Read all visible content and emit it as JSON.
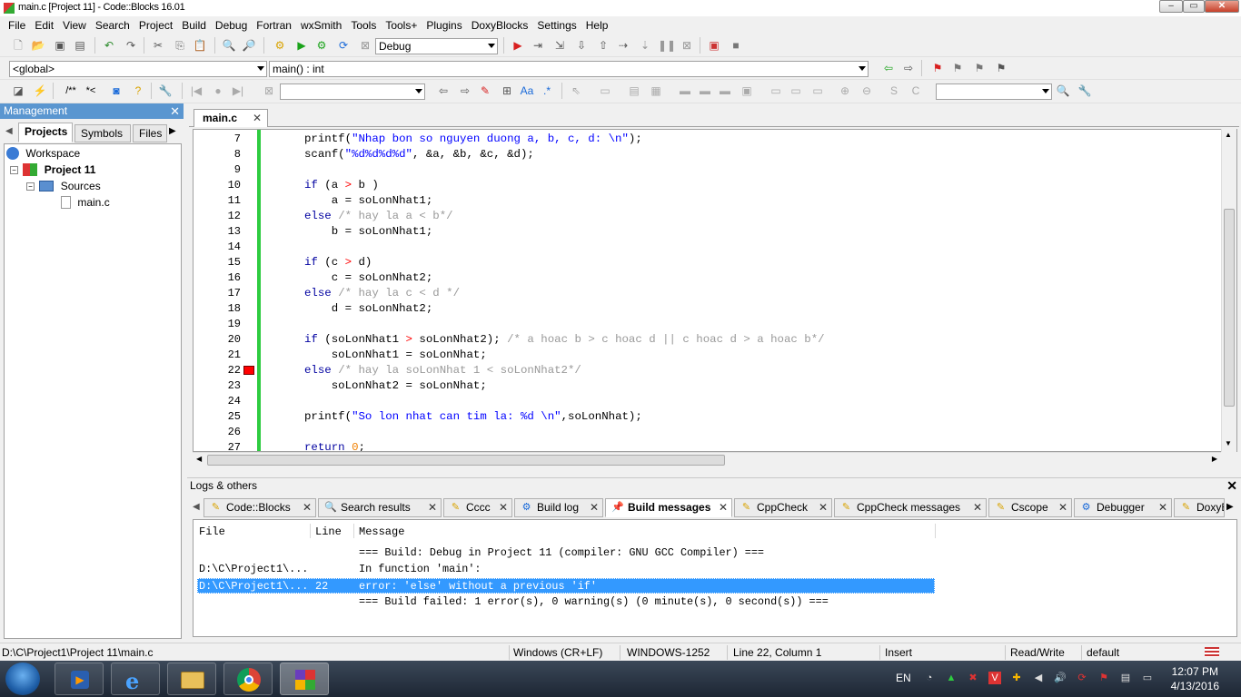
{
  "window": {
    "title": "main.c [Project 11] - Code::Blocks 16.01",
    "buttons": [
      "–",
      "▭",
      "✕"
    ]
  },
  "menu": [
    "File",
    "Edit",
    "View",
    "Search",
    "Project",
    "Build",
    "Debug",
    "Fortran",
    "wxSmith",
    "Tools",
    "Tools+",
    "Plugins",
    "DoxyBlocks",
    "Settings",
    "Help"
  ],
  "toolbar": {
    "build_target": "Debug"
  },
  "code_nav": {
    "scope": "<global>",
    "function": "main() : int"
  },
  "management": {
    "title": "Management",
    "tabs": [
      "Projects",
      "Symbols",
      "Files"
    ],
    "tree": {
      "workspace": "Workspace",
      "project": "Project 11",
      "folder": "Sources",
      "file": "main.c"
    }
  },
  "editor": {
    "tab": "main.c",
    "error_line": 22,
    "lines": [
      {
        "n": "7",
        "html": "printf(<span class='str'>\"Nhap bon so nguyen duong a, b, c, d: \\n\"</span>);"
      },
      {
        "n": "8",
        "html": "scanf(<span class='str'>\"%d%d%d%d\"</span>, &amp;a, &amp;b, &amp;c, &amp;d);"
      },
      {
        "n": "9",
        "html": ""
      },
      {
        "n": "10",
        "html": "<span class='kw'>if</span> (a <span class='op'>&gt;</span> b )"
      },
      {
        "n": "11",
        "html": "    a = soLonNhat1;"
      },
      {
        "n": "12",
        "html": "<span class='kw'>else</span> <span class='cm'>/* hay la a &lt; b*/</span>"
      },
      {
        "n": "13",
        "html": "    b = soLonNhat1;"
      },
      {
        "n": "14",
        "html": ""
      },
      {
        "n": "15",
        "html": "<span class='kw'>if</span> (c <span class='op'>&gt;</span> d)"
      },
      {
        "n": "16",
        "html": "    c = soLonNhat2;"
      },
      {
        "n": "17",
        "html": "<span class='kw'>else</span> <span class='cm'>/* hay la c &lt; d */</span>"
      },
      {
        "n": "18",
        "html": "    d = soLonNhat2;"
      },
      {
        "n": "19",
        "html": ""
      },
      {
        "n": "20",
        "html": "<span class='kw'>if</span> (soLonNhat1 <span class='op'>&gt;</span> soLonNhat2); <span class='cm'>/* a hoac b &gt; c hoac d || c hoac d &gt; a hoac b*/</span>"
      },
      {
        "n": "21",
        "html": "    soLonNhat1 = soLonNhat;"
      },
      {
        "n": "22",
        "html": "<span class='kw'>else</span> <span class='cm'>/* hay la soLonNhat 1 &lt; soLonNhat2*/</span>"
      },
      {
        "n": "23",
        "html": "    soLonNhat2 = soLonNhat;"
      },
      {
        "n": "24",
        "html": ""
      },
      {
        "n": "25",
        "html": "printf(<span class='str'>\"So lon nhat can tim la: %d \\n\"</span>,soLonNhat);"
      },
      {
        "n": "26",
        "html": ""
      },
      {
        "n": "27",
        "html": "<span class='kw'>return</span> <span class='nm'>0</span>;"
      }
    ]
  },
  "logs": {
    "title": "Logs & others",
    "tabs": [
      "Code::Blocks",
      "Search results",
      "Cccc",
      "Build log",
      "Build messages",
      "CppCheck",
      "CppCheck messages",
      "Cscope",
      "Debugger",
      "DoxyB"
    ],
    "columns": {
      "file": "File",
      "line": "Line",
      "message": "Message"
    },
    "rows": [
      {
        "file": "",
        "line": "",
        "message": "=== Build: Debug in Project 11 (compiler: GNU GCC Compiler) ==="
      },
      {
        "file": "D:\\C\\Project1\\...",
        "line": "",
        "message": "In function 'main':"
      },
      {
        "file": "D:\\C\\Project1\\...",
        "line": "22",
        "message": "error: 'else' without a previous 'if'"
      },
      {
        "file": "",
        "line": "",
        "message": "=== Build failed: 1 error(s), 0 warning(s) (0 minute(s), 0 second(s)) ==="
      }
    ]
  },
  "status": {
    "path": "D:\\C\\Project1\\Project 11\\main.c",
    "eol": "Windows (CR+LF)",
    "encoding": "WINDOWS-1252",
    "position": "Line 22, Column 1",
    "mode": "Insert",
    "access": "Read/Write",
    "profile": "default"
  },
  "taskbar": {
    "lang": "EN",
    "time": "12:07 PM",
    "date": "4/13/2016"
  },
  "colors": {
    "accent": "#5a96d0",
    "selection": "#3399ff",
    "changebar": "#2ecc40",
    "error_marker": "#ff0000"
  }
}
